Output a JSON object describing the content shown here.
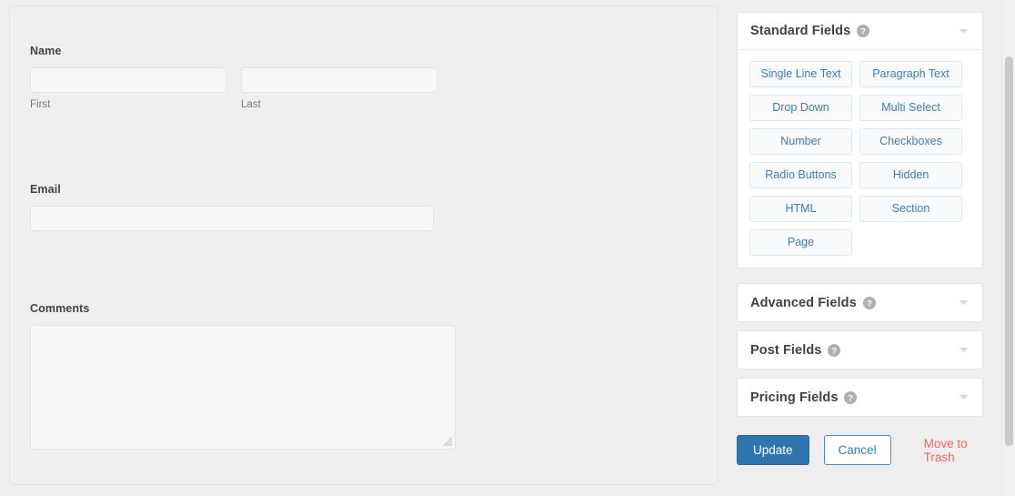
{
  "form": {
    "fields": [
      {
        "label": "Name",
        "type": "name",
        "first": {
          "value": "",
          "placeholder": "",
          "sublabel": "First"
        },
        "last": {
          "value": "",
          "placeholder": "",
          "sublabel": "Last"
        }
      },
      {
        "label": "Email",
        "type": "email",
        "value": "",
        "placeholder": ""
      },
      {
        "label": "Comments",
        "type": "textarea",
        "value": "",
        "placeholder": ""
      }
    ]
  },
  "palette": {
    "panels": [
      {
        "title": "Standard Fields",
        "help_icon": "help-circle-icon",
        "caret_icon": "chevron-down-icon",
        "expanded": true,
        "buttons": [
          "Single Line Text",
          "Paragraph Text",
          "Drop Down",
          "Multi Select",
          "Number",
          "Checkboxes",
          "Radio Buttons",
          "Hidden",
          "HTML",
          "Section",
          "Page"
        ]
      },
      {
        "title": "Advanced Fields",
        "help_icon": "help-circle-icon",
        "caret_icon": "chevron-down-icon",
        "expanded": false,
        "buttons": []
      },
      {
        "title": "Post Fields",
        "help_icon": "help-circle-icon",
        "caret_icon": "chevron-down-icon",
        "expanded": false,
        "buttons": []
      },
      {
        "title": "Pricing Fields",
        "help_icon": "help-circle-icon",
        "caret_icon": "chevron-down-icon",
        "expanded": false,
        "buttons": []
      }
    ]
  },
  "actions": {
    "update_label": "Update",
    "cancel_label": "Cancel",
    "trash_label": "Move to Trash"
  },
  "colors": {
    "primary": "#2e74ad",
    "link_blue": "#3d7cb5",
    "danger": "#f4645f",
    "page_bg": "#eeeeee",
    "panel_bg": "#ffffff",
    "input_bg": "#f7f7f7"
  }
}
